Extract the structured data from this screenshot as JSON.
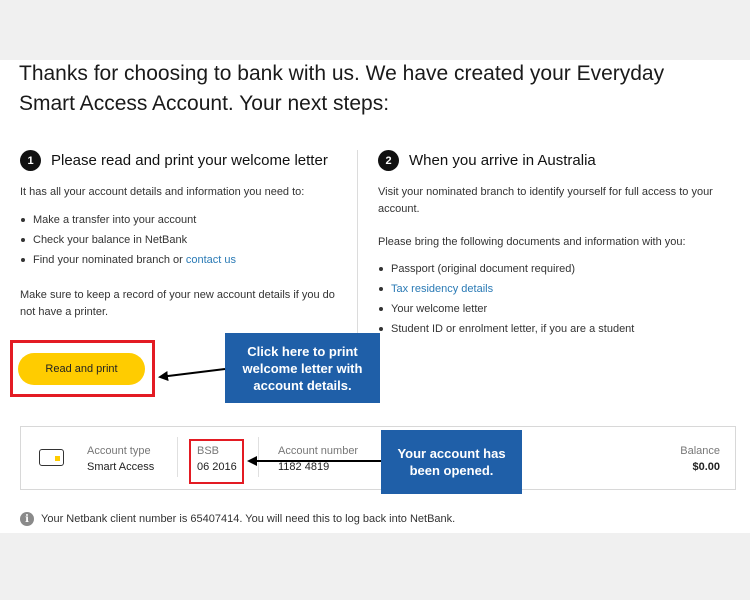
{
  "headline": "Thanks for choosing to bank with us. We have created your Everyday Smart Access Account. Your next steps:",
  "step1": {
    "number": "1",
    "title": "Please read and print your welcome letter",
    "intro": "It has all your account details and information you need to:",
    "items": [
      "Make a transfer into your account",
      "Check your balance in NetBank",
      "Find your nominated branch or "
    ],
    "contact_link": "contact us",
    "note": "Make sure to keep a record of your new account details if you do not have a printer.",
    "button_label": "Read and print"
  },
  "step2": {
    "number": "2",
    "title": "When you arrive in Australia",
    "intro": "Visit your nominated branch to identify yourself for full access to your account.",
    "docs_intro": "Please bring the following documents and information with you:",
    "items": [
      "Passport (original document required)",
      "Tax residency details",
      "Your welcome letter",
      "Student ID or enrolment letter, if you are a student"
    ]
  },
  "account": {
    "type_label": "Account type",
    "type_value": "Smart Access",
    "bsb_label": "BSB",
    "bsb_value": "06 2016",
    "number_label": "Account number",
    "number_value": "1182 4819",
    "balance_label": "Balance",
    "balance_value": "$0.00"
  },
  "callouts": {
    "print": "Click here to print welcome letter with account details.",
    "opened": "Your account has been opened."
  },
  "info_icon": "info-icon",
  "client_note": "Your Netbank client number is 65407414. You will need this to log back into NetBank.",
  "colors": {
    "accent_yellow": "#ffcc00",
    "callout_blue": "#1f5fa8",
    "highlight_red": "#e31b23",
    "link_blue": "#2a7ab5"
  }
}
